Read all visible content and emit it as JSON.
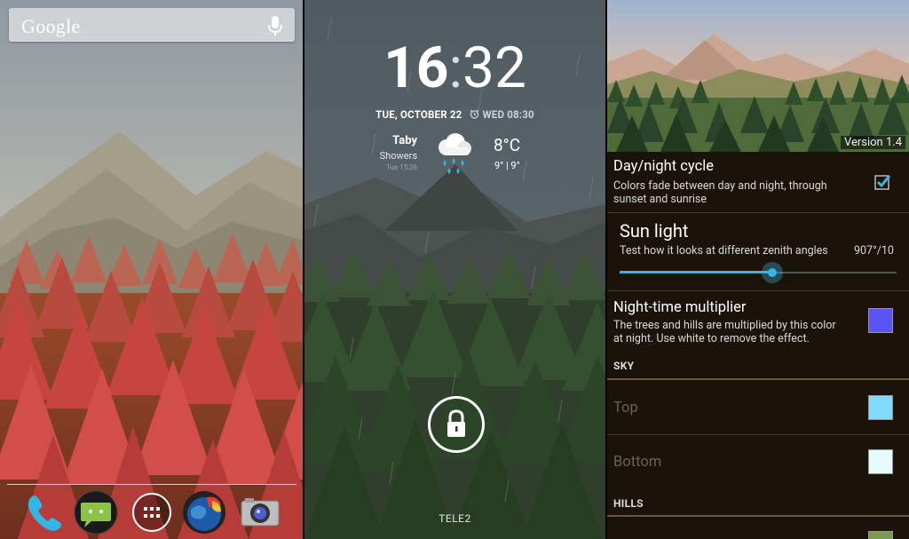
{
  "home": {
    "search_logo": "Google",
    "dock": [
      {
        "name": "phone-app-icon",
        "color": "#33b5e5"
      },
      {
        "name": "messaging-app-icon",
        "color": "#8bc34a"
      },
      {
        "name": "all-apps-icon",
        "color": "#ffffff"
      },
      {
        "name": "browser-app-icon",
        "color": "#1e5aa8"
      },
      {
        "name": "camera-app-icon",
        "color": "#9e9e9e"
      }
    ]
  },
  "lock": {
    "clock_hour": "16",
    "clock_sep": ":",
    "clock_min": "32",
    "date": "TUE, OCTOBER 22",
    "alarm": "WED 08:30",
    "weather": {
      "city": "Taby",
      "condition": "Showers",
      "updated": "Tue 15:36",
      "temp": "8°C",
      "range": "9° | 9°"
    },
    "carrier": "TELE2"
  },
  "settings": {
    "version": "Version 1.4",
    "day_night": {
      "title": "Day/night cycle",
      "summary_1": "Colors fade between day and night, through",
      "summary_2": "sunset and sunrise",
      "checked": true
    },
    "sun_light": {
      "title": "Sun light",
      "summary": "Test how it looks at different zenith angles",
      "value": "907°/10",
      "slider_fraction": 0.55
    },
    "night_mult": {
      "title": "Night-time multiplier",
      "summary_1": "The trees and hills are multiplied by this color",
      "summary_2": "at night. Use white to remove the effect.",
      "color": "#5a54f5"
    },
    "sky_header": "SKY",
    "sky_top": {
      "label": "Top",
      "color": "#80dcff"
    },
    "sky_bottom": {
      "label": "Bottom",
      "color": "#e6fbff"
    },
    "hills_header": "HILLS",
    "hills_swatch_color": "#7a9a50"
  }
}
